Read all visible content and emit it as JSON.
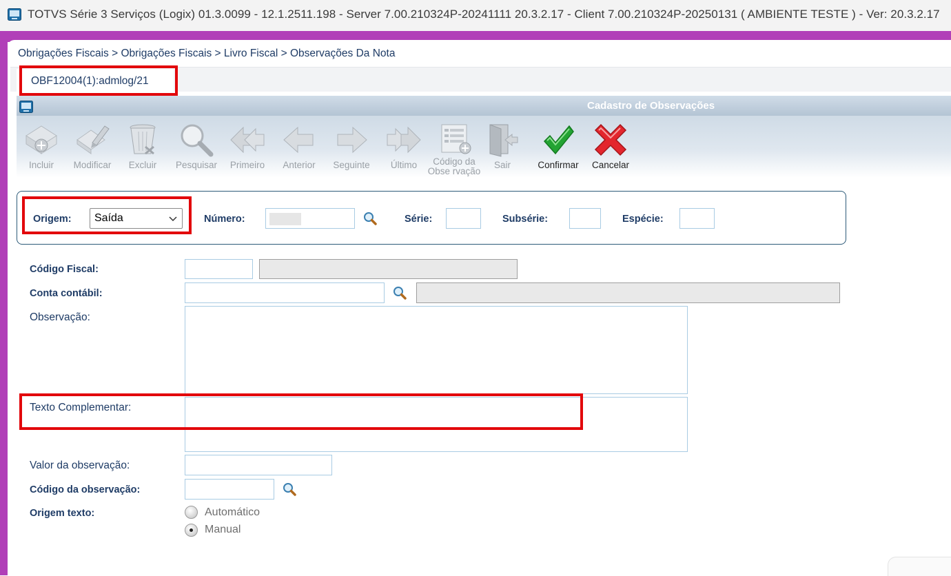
{
  "window": {
    "title": "TOTVS Série 3 Serviços (Logix) 01.3.0099  -  12.1.2511.198 - Server 7.00.210324P-20241111 20.3.2.17 - Client 7.00.210324P-20250131    ( AMBIENTE TESTE )  - Ver: 20.3.2.17"
  },
  "breadcrumb": "Obrigações Fiscais > Obrigações Fiscais > Livro Fiscal > Observações Da Nota",
  "tab": {
    "label": "OBF12004(1):admlog/21"
  },
  "form_window": {
    "title": "Cadastro de Observações"
  },
  "toolbar": {
    "incluir": "Incluir",
    "modificar": "Modificar",
    "excluir": "Excluir",
    "pesquisar": "Pesquisar",
    "primeiro": "Primeiro",
    "anterior": "Anterior",
    "seguinte": "Seguinte",
    "ultimo": "Último",
    "codigo_obs_1": "Código da",
    "codigo_obs_2": "Obse rvação",
    "sair": "Sair",
    "confirmar": "Confirmar",
    "cancelar": "Cancelar"
  },
  "key_panel": {
    "origem_label": "Origem:",
    "origem_value": "Saída",
    "numero_label": "Número:",
    "serie_label": "Série:",
    "subserie_label": "Subsérie:",
    "especie_label": "Espécie:"
  },
  "fields": {
    "codigo_fiscal_label": "Código Fiscal:",
    "conta_contabil_label": "Conta contábil:",
    "observacao_label": "Observação:",
    "texto_complementar_label": "Texto Complementar:",
    "valor_observacao_label": "Valor da observação:",
    "codigo_observacao_label": "Código da observação:",
    "origem_texto_label": "Origem texto:"
  },
  "origem_texto": {
    "options": [
      "Automático",
      "Manual"
    ],
    "selected": "Manual"
  },
  "colors": {
    "frame": "#b13fb8",
    "highlight": "#e2060b",
    "label": "#1f3c66"
  }
}
